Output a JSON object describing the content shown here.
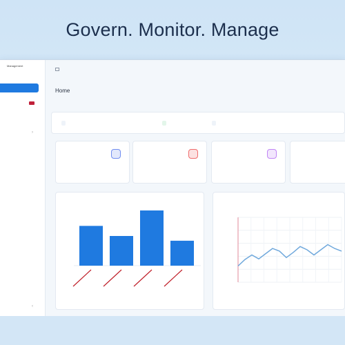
{
  "hero": {
    "title": "Govern. Monitor. Manage"
  },
  "sidebar": {
    "brand": "Management",
    "items": [
      {
        "label": "",
        "active": true
      },
      {
        "label": "",
        "badge": true
      },
      {
        "label": ""
      },
      {
        "label": "",
        "chevron": true
      },
      {
        "label": ""
      },
      {
        "label": ""
      },
      {
        "label": ""
      },
      {
        "label": ""
      },
      {
        "label": ""
      },
      {
        "label": ""
      },
      {
        "label": ""
      },
      {
        "label": ""
      },
      {
        "label": ""
      }
    ]
  },
  "breadcrumb": {
    "items": [
      "",
      "",
      ""
    ]
  },
  "page": {
    "title": "Home",
    "subtitle": ""
  },
  "filters": {
    "first_label": "",
    "first_value": "",
    "status_label": "",
    "status_value": "",
    "range_label": "",
    "range_value": ""
  },
  "kpis": [
    {
      "label": "",
      "value": "",
      "sub1": "",
      "sub2": "",
      "icon": "chart-icon",
      "color": "#6f8cf0"
    },
    {
      "label": "",
      "value": "",
      "sub1": "",
      "sub2": "",
      "icon": "alert-icon",
      "color": "#ef6b6b"
    },
    {
      "label": "",
      "value": "",
      "sub1": "",
      "sub2": "",
      "icon": "user-icon",
      "color": "#c084f5"
    },
    {
      "label": "",
      "value": "",
      "sub1": "",
      "sub2": "",
      "icon": "shield-icon",
      "color": "#f0a44e"
    }
  ],
  "bar_card": {
    "title": "",
    "subtitle": "",
    "highlight": ""
  },
  "line_card": {
    "title": "",
    "subtitle": "",
    "legend": [
      "",
      ""
    ]
  },
  "chart_data": [
    {
      "type": "bar",
      "categories": [
        "",
        "",
        "",
        ""
      ],
      "values": [
        0.67,
        0.5,
        0.93,
        0.42
      ],
      "ylim": [
        0,
        1
      ],
      "grid": false,
      "color": "#1f7ae0"
    },
    {
      "type": "line",
      "x": [
        0,
        1,
        2,
        3,
        4,
        5,
        6,
        7,
        8,
        9,
        10,
        11,
        12,
        13,
        14,
        15
      ],
      "series": [
        {
          "values": [
            0.25,
            0.35,
            0.42,
            0.36,
            0.44,
            0.52,
            0.48,
            0.38,
            0.46,
            0.55,
            0.5,
            0.42,
            0.5,
            0.58,
            0.52,
            0.48
          ],
          "color": "#6fa8dc"
        }
      ],
      "ylim": [
        0,
        1
      ],
      "grid": true,
      "legend": "bottom"
    }
  ]
}
